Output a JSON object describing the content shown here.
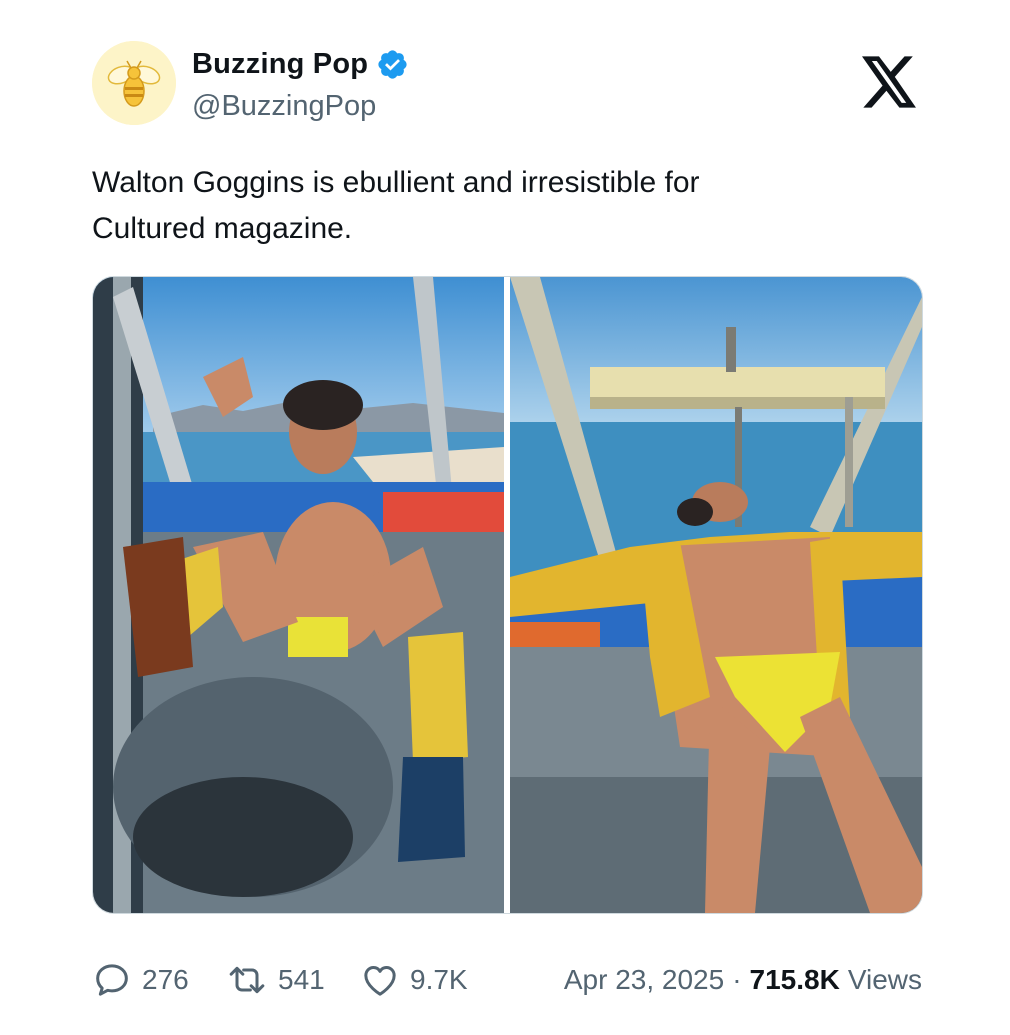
{
  "author": {
    "display_name": "Buzzing Pop",
    "handle": "@BuzzingPop",
    "verified": true,
    "avatar_icon": "bee-icon",
    "verified_color": "#1d9bf0"
  },
  "platform_icon": "x-logo-icon",
  "tweet": {
    "text_line1": "Walton Goggins is ebullient and irresistible for",
    "text_line2": "Cultured magazine."
  },
  "media": {
    "count": 2
  },
  "actions": {
    "reply_count": "276",
    "retweet_count": "541",
    "like_count": "9.7K"
  },
  "meta": {
    "date": "Apr 23, 2025",
    "separator": "·",
    "views_count": "715.8K",
    "views_label": "Views"
  },
  "colors": {
    "text": "#0f1419",
    "secondary": "#536471",
    "accent": "#1d9bf0"
  }
}
